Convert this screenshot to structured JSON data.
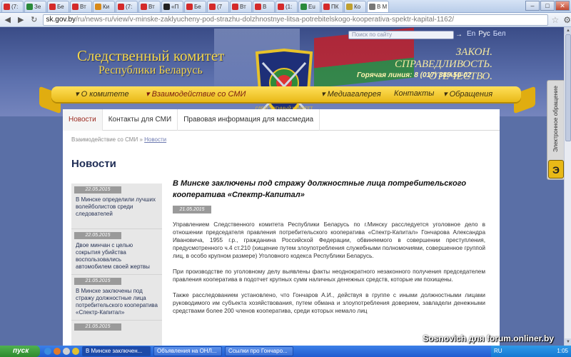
{
  "browser": {
    "tabs": [
      {
        "label": "(7:",
        "color": "#d42a2a"
      },
      {
        "label": "Зе",
        "color": "#2a8a3a"
      },
      {
        "label": "Бе",
        "color": "#d42a2a"
      },
      {
        "label": "Вт",
        "color": "#d42a2a"
      },
      {
        "label": "Ки",
        "color": "#d88a1a"
      },
      {
        "label": "(7:",
        "color": "#d42a2a"
      },
      {
        "label": "Вт",
        "color": "#d42a2a"
      },
      {
        "label": "«П",
        "color": "#222222"
      },
      {
        "label": "Бе",
        "color": "#d42a2a"
      },
      {
        "label": "(7",
        "color": "#d42a2a"
      },
      {
        "label": "Вт",
        "color": "#d42a2a"
      },
      {
        "label": "В",
        "color": "#d42a2a"
      },
      {
        "label": "(1:",
        "color": "#d42a2a"
      },
      {
        "label": "Eu",
        "color": "#2a8a3a"
      },
      {
        "label": "ПК",
        "color": "#d42a2a"
      },
      {
        "label": "Ко",
        "color": "#c0a030"
      },
      {
        "label": "В М",
        "color": "#777777"
      }
    ],
    "url_host": "sk.gov.by",
    "url_path": "/ru/news-ru/view/v-minske-zaklyucheny-pod-strazhu-dolzhnostnye-litsa-potrebitelskogo-kooperativa-spektr-kapital-1162/"
  },
  "site": {
    "title_line1": "Следственный комитет",
    "title_line2": "Республики Беларусь",
    "motto_line1": "ЗАКОН.",
    "motto_line2": "СПРАВЕДЛИВОСТЬ. ОТЕЧЕСТВО.",
    "hotline": "Горячая линия: 8 (017) 389-50-02",
    "search_placeholder": "Поиск по сайту",
    "languages": [
      "En",
      "Рус",
      "Бел"
    ],
    "emblem_text": "СЛЕДСТВЕННЫЙ КОМИТЕТ"
  },
  "nav": {
    "items": [
      "О комитете",
      "Взаимодействие со СМИ",
      "Медиагалерея",
      "Контакты",
      "Обращения"
    ]
  },
  "subtabs": [
    "Новости",
    "Контакты для СМИ",
    "Правовая информация для массмедиа"
  ],
  "breadcrumb": {
    "parent": "Взаимодействие со СМИ",
    "separator": "»",
    "current": "Новости"
  },
  "page_title": "Новости",
  "news_list": [
    {
      "date": "22.05.2015",
      "text": "В Минске определили лучших волейболистов среди следователей"
    },
    {
      "date": "22.05.2015",
      "text": "Двое минчан с целью сокрытия убийства воспользовались автомобилем своей жертвы"
    },
    {
      "date": "21.05.2015",
      "text": "В Минске заключены под стражу должностные лица потребительского кооператива «Спектр-Капитал»"
    },
    {
      "date": "21.05.2015",
      "text": ""
    }
  ],
  "article": {
    "title": "В Минске заключены под стражу должностные лица потребительского кооператива «Спектр-Капитал»",
    "date": "21.05.2015",
    "paragraphs": [
      "Управлением Следственного комитета Республики Беларусь по г.Минску расследуется уголовное дело в отношении председателя правления потребительского кооператива «Спектр-Капитал» Гончарова Александра Ивановича, 1955 г.р., гражданина Российской Федерации, обвиняемого в совершении преступления, предусмотренного ч.4 ст.210 (хищение путем злоупотребления служебными полномочиями, совершенное группой лиц, в особо крупном размере) Уголовного кодекса Республики Беларусь.",
      "При производстве по уголовному делу выявлены факты неоднократного незаконного получения председателем правления кооператива в подотчет крупных сумм наличных денежных средств, которые им похищены.",
      "Также расследованием установлено, что Гончаров А.И., действуя в группе с иными должностными лицами руководимого им субъекта хозяйствования, путем обмана и злоупотребления доверием, завладели денежными средствами более 200 членов кооператива, среди которых немало лиц"
    ]
  },
  "side_panel": {
    "label": "Электронное обращение",
    "button": "Э"
  },
  "taskbar": {
    "start": "пуск",
    "tasks": [
      "В Минске заключен...",
      "Объявления на ОНЛ...",
      "Ссылки про Гончаро..."
    ],
    "tray_lang": "RU",
    "clock": "1:05"
  },
  "watermark": "Sosnovich для forum.onliner.by"
}
